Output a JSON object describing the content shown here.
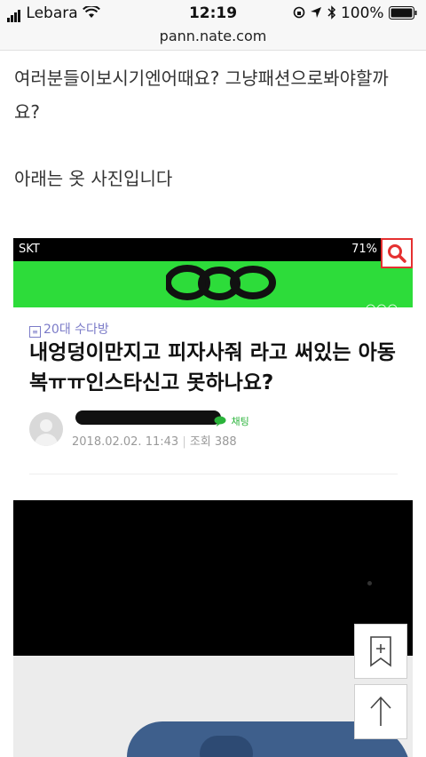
{
  "status_bar": {
    "carrier": "Lebara",
    "time": "12:19",
    "battery": "100%"
  },
  "browser": {
    "url": "pann.nate.com"
  },
  "article": {
    "line1": "여러분들이보시기엔어때요? 그냥패션으로봐야할까",
    "line2": "요?",
    "line3": "아래는 옷 사진입니다"
  },
  "embedded_screenshot": {
    "status_left": "SKT",
    "status_right": "71%",
    "board": "20대 수다방",
    "headline": "내엉덩이만지고 피자사줘 라고 써있는 아동복ㅠㅠ인스타신고 못하나요?",
    "chat_label": "채팅",
    "date": "2018.02.02. 11:43",
    "views_label": "조회",
    "views": "388"
  }
}
